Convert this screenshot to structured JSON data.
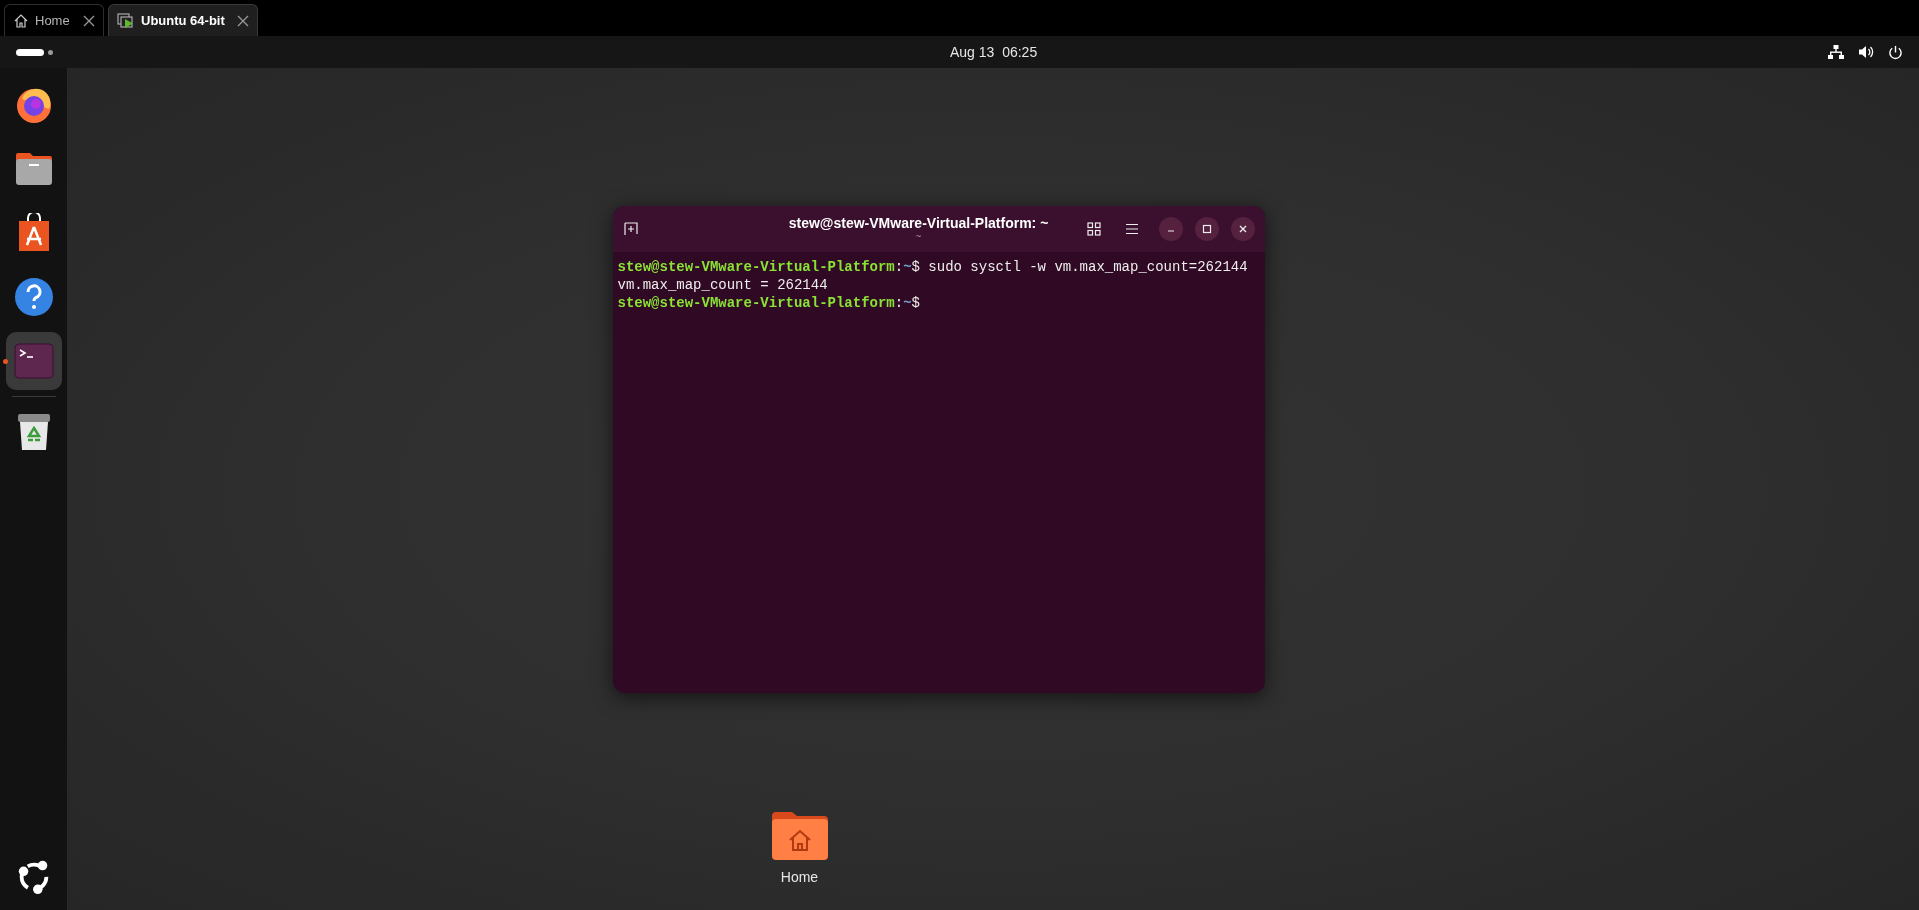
{
  "browser_tabs": [
    {
      "label": "Home",
      "kind": "home",
      "selected": false
    },
    {
      "label": "Ubuntu 64-bit",
      "kind": "vm",
      "selected": true
    }
  ],
  "top_panel": {
    "clock": "Aug 13  06:25"
  },
  "dock": {
    "items": [
      {
        "kind": "firefox",
        "running": false
      },
      {
        "kind": "files",
        "running": false
      },
      {
        "kind": "store",
        "running": false
      },
      {
        "kind": "help",
        "running": false
      },
      {
        "kind": "terminal",
        "running": true
      },
      {
        "kind": "trash",
        "running": false
      }
    ]
  },
  "terminal": {
    "title": "stew@stew-VMware-Virtual-Platform: ~",
    "subtitle": "~",
    "lines": [
      {
        "kind": "prompt",
        "prompt": "stew@stew-VMware-Virtual-Platform",
        "separator": ":",
        "path": "~",
        "command": "$ sudo sysctl -w vm.max_map_count=262144"
      },
      {
        "kind": "output",
        "text": "vm.max_map_count = 262144"
      },
      {
        "kind": "prompt",
        "prompt": "stew@stew-VMware-Virtual-Platform",
        "separator": ":",
        "path": "~",
        "command": "$"
      }
    ]
  },
  "desktop_icons": [
    {
      "label": "Home"
    }
  ]
}
